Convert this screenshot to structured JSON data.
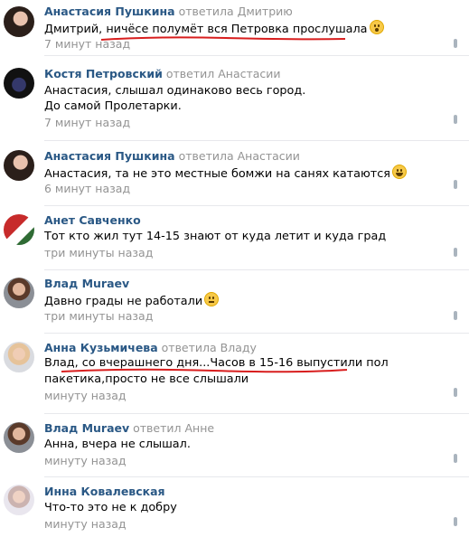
{
  "comments": [
    {
      "author": "Анастасия Пушкина",
      "reply": "ответила Дмитрию",
      "text": "Дмитрий, ничёсе полумёт вся Петровка прослушала",
      "emoji": "wow",
      "date": "7 минут назад"
    },
    {
      "author": "Костя Петровский",
      "reply": "ответил Анастасии",
      "text": "Анастасия, слышал одинаково весь город.",
      "text2": "До самой Пролетарки.",
      "date": "7 минут назад"
    },
    {
      "author": "Анастасия Пушкина",
      "reply": "ответила Анастасии",
      "text": "Анастасия, та не это местные бомжи на санях катаются",
      "emoji": "laugh",
      "date": "6 минут назад"
    },
    {
      "author": "Анет Савченко",
      "reply": "",
      "text": "Тот кто жил тут 14-15 знают от куда летит и куда град",
      "date": "три минуты назад"
    },
    {
      "author": "Влад Muraev",
      "reply": "",
      "text": "Давно грады не работали",
      "emoji": "eyes",
      "date": "три минуты назад"
    },
    {
      "author": "Анна Кузьмичева",
      "reply": "ответила Владу",
      "text": "Влад, со вчерашнего дня...Часов в 15-16 выпустили пол пакетика,просто не все слышали",
      "date": "минуту назад"
    },
    {
      "author": "Влад Muraev",
      "reply": "ответил Анне",
      "text": "Анна, вчера не слышал.",
      "date": "минуту назад"
    },
    {
      "author": "Инна Ковалевская",
      "reply": "",
      "text": "Что-то это не к добру",
      "date": "минуту назад"
    }
  ],
  "colors": {
    "author": "#2a5885",
    "meta": "#939393",
    "annotation": "#d81e1e"
  }
}
